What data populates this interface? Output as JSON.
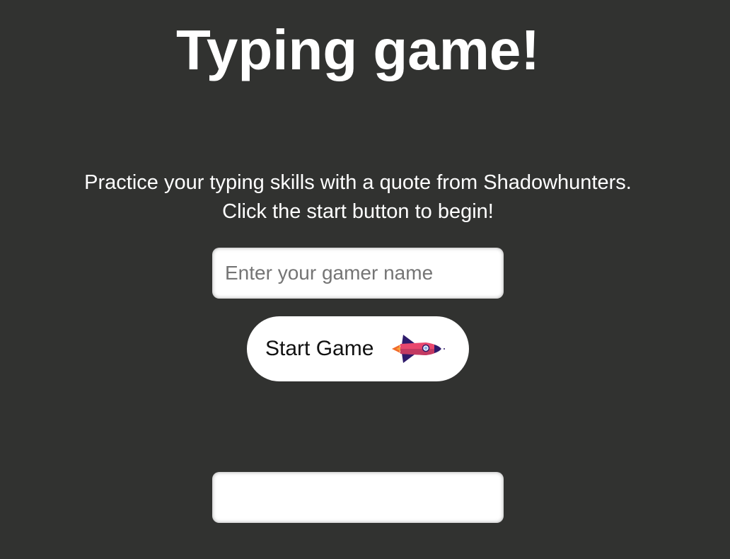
{
  "header": {
    "title": "Typing game!"
  },
  "instructions": {
    "line1": "Practice your typing skills with a quote from Shadowhunters.",
    "line2": "Click the start button to begin!"
  },
  "name_input": {
    "value": "",
    "placeholder": "Enter your gamer name"
  },
  "start_button": {
    "label": "Start Game",
    "icon": "rocket-icon"
  },
  "typed_input": {
    "value": "",
    "placeholder": ""
  },
  "colors": {
    "background": "#313230",
    "text": "#ffffff",
    "button_background": "#ffffff",
    "rocket_body": "#e8476e",
    "rocket_fins": "#2e1a6b",
    "rocket_flame": "#f26b2a"
  }
}
